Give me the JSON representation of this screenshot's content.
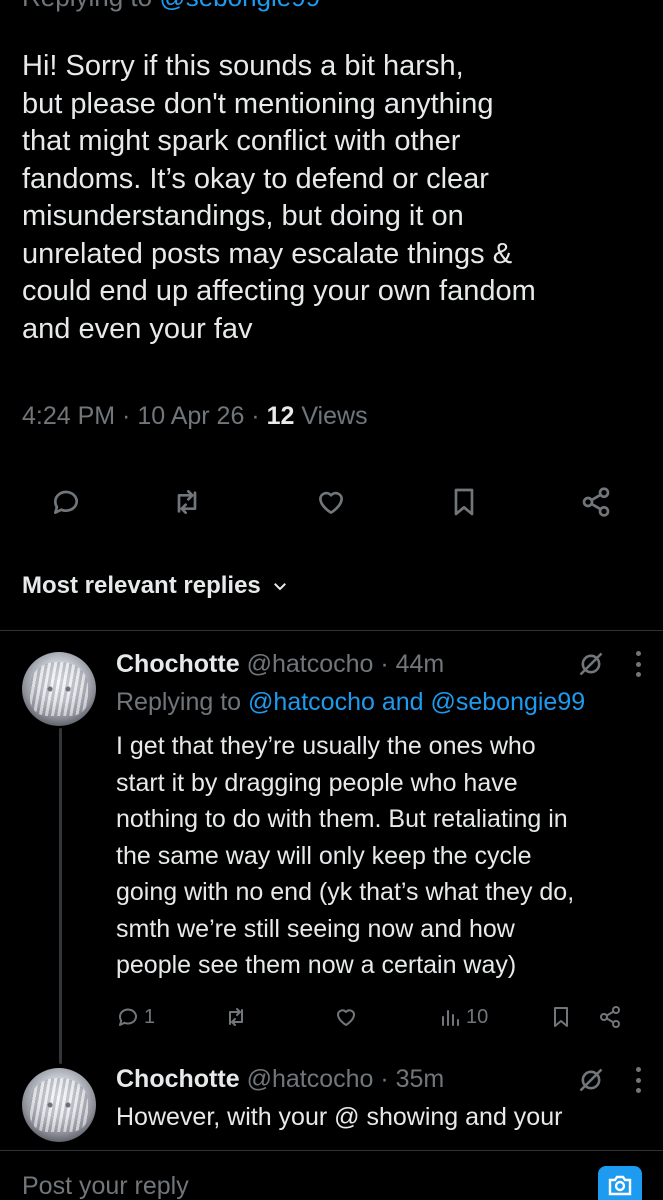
{
  "header": {
    "replying_prefix": "Replying to ",
    "replying_handle": "@sebongie99"
  },
  "tweet": {
    "text": "Hi! Sorry if this sounds a bit harsh,\nbut please don't mentioning anything\nthat might spark conflict with other\nfandoms. It’s okay to defend or clear\nmisunderstandings, but doing it on\nunrelated posts may escalate things &\ncould end up affecting your own fandom\nand even your fav",
    "time": "4:24 PM",
    "sep1": " · ",
    "date": "10 Apr 26",
    "sep2": " · ",
    "views_count": "12",
    "views_label": " Views"
  },
  "actions": {
    "icons": [
      "reply-icon",
      "retweet-icon",
      "like-icon",
      "bookmark-icon",
      "share-icon"
    ]
  },
  "sort": {
    "label": "Most relevant replies"
  },
  "replies": [
    {
      "name": "Chochotte",
      "handle": "@hatcocho",
      "sep": " · ",
      "time": "44m",
      "replying_prefix": "Replying to ",
      "replying_handles": "@hatcocho and @sebongie99",
      "text": "I get that they’re usually the ones who\nstart it by dragging people who have\nnothing to do with them. But retaliating in\nthe same way will only keep the cycle\ngoing with no end (yk that’s what they do,\nsmth we’re still seeing now and how\npeople see them now a certain way)",
      "reply_count": "1",
      "view_count": "10"
    },
    {
      "name": "Chochotte",
      "handle": "@hatcocho",
      "sep": " · ",
      "time": "35m",
      "text": "However, with your @ showing and your"
    }
  ],
  "compose": {
    "placeholder": "Post your reply"
  },
  "colors": {
    "background": "#000000",
    "text": "#e7e9ea",
    "muted": "#71767b",
    "accent": "#1d9bf0",
    "divider": "#2f3336"
  }
}
